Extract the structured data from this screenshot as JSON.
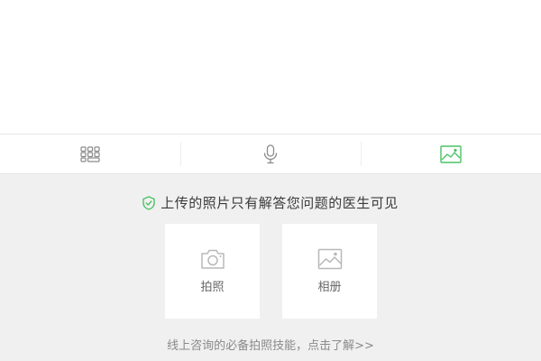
{
  "toolbar": {
    "items": [
      {
        "icon": "keyboard-icon"
      },
      {
        "icon": "microphone-icon"
      },
      {
        "icon": "image-icon",
        "active_color": "#4cc266"
      }
    ]
  },
  "panel": {
    "notice": "上传的照片只有解答您问题的医生可见",
    "notice_icon": "shield-check-icon",
    "options": [
      {
        "label": "拍照",
        "icon": "camera-icon"
      },
      {
        "label": "相册",
        "icon": "photo-album-icon"
      }
    ],
    "tip": "线上咨询的必备拍照技能，点击了解>>"
  },
  "colors": {
    "accent": "#4cc266",
    "panel_bg": "#f0f0f0",
    "icon_gray": "#8a8a8a"
  }
}
